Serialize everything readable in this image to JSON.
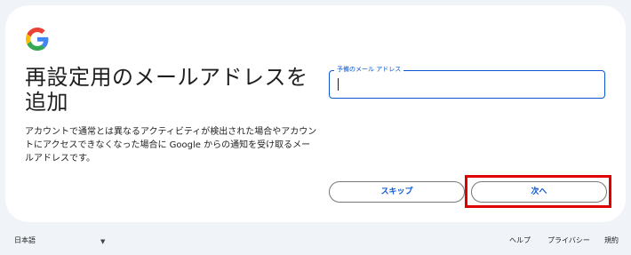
{
  "title": "再設定用のメールアドレスを追加",
  "description": "アカウントで通常とは異なるアクティビティが検出された場合やアカウントにアクセスできなくなった場合に Google からの通知を受け取るメールアドレスです。",
  "email_field": {
    "label": "予備のメール アドレス",
    "value": ""
  },
  "buttons": {
    "skip": "スキップ",
    "next": "次へ"
  },
  "footer": {
    "language": "日本語",
    "language_caret_icon": "triangle-down",
    "help": "ヘルプ",
    "privacy": "プライバシー",
    "terms": "規約"
  },
  "colors": {
    "accent": "#0b57d0",
    "highlight": "#e00000",
    "background": "#f0f4f9"
  }
}
